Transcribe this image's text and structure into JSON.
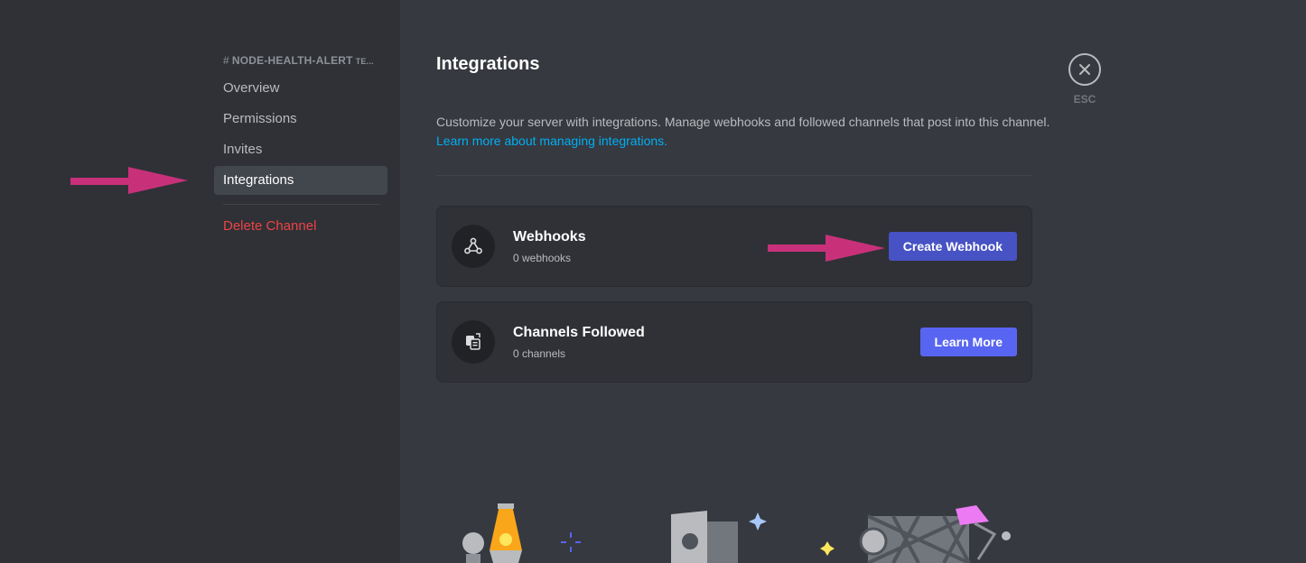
{
  "sidebar": {
    "channel_name": "NODE-HEALTH-ALERT",
    "channel_tail": "TE...",
    "items": [
      {
        "label": "Overview"
      },
      {
        "label": "Permissions"
      },
      {
        "label": "Invites"
      },
      {
        "label": "Integrations"
      },
      {
        "label": "Delete Channel"
      }
    ]
  },
  "main": {
    "title": "Integrations",
    "description": "Customize your server with integrations. Manage webhooks and followed channels that post into this channel.",
    "learn_link": "Learn more about managing integrations.",
    "cards": [
      {
        "title": "Webhooks",
        "subtitle": "0 webhooks",
        "button": "Create Webhook",
        "icon": "webhook-icon"
      },
      {
        "title": "Channels Followed",
        "subtitle": "0 channels",
        "button": "Learn More",
        "icon": "channel-follow-icon"
      }
    ]
  },
  "close": {
    "label": "ESC",
    "icon": "close-icon"
  },
  "colors": {
    "accent": "#5865f2",
    "danger": "#ed4245",
    "link": "#00aff4",
    "annotation_arrow": "#c8317a"
  }
}
